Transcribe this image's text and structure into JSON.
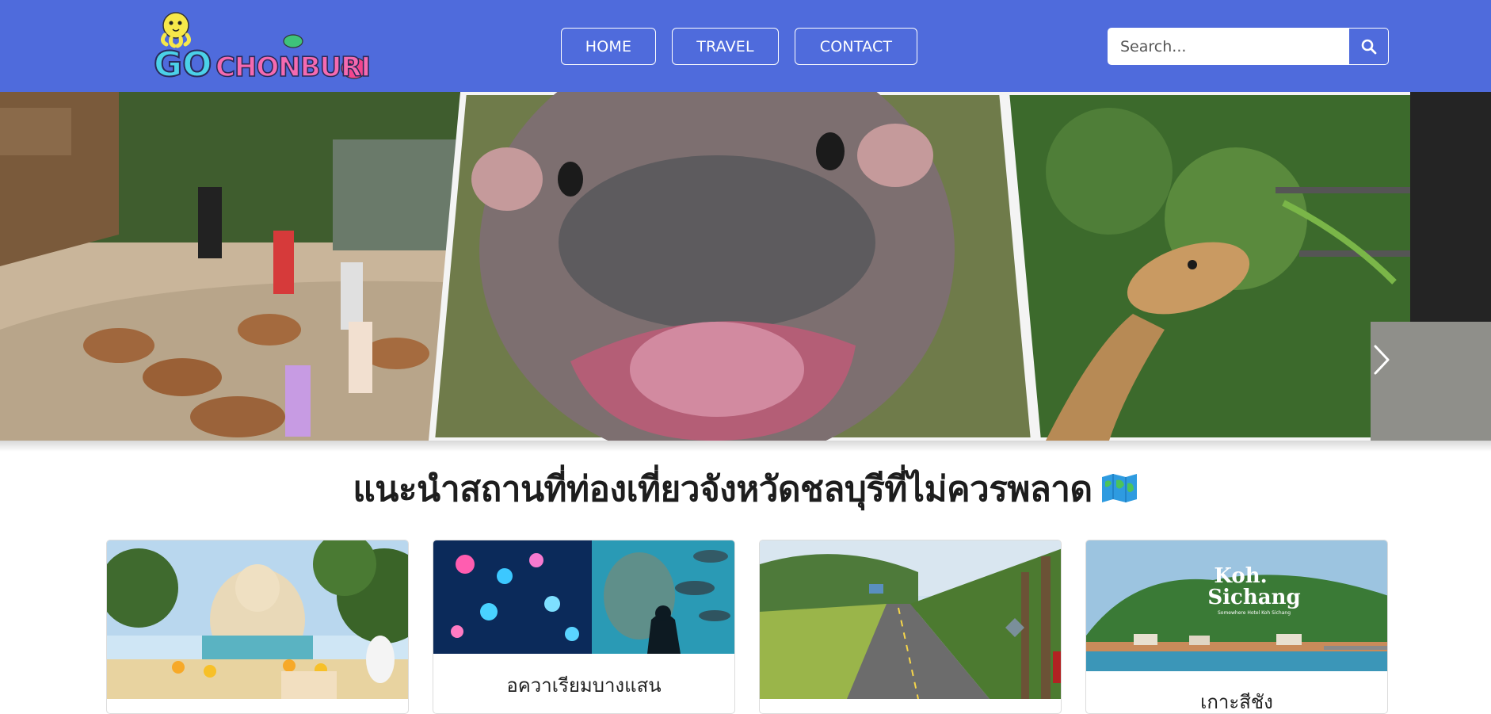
{
  "brand": {
    "logo_text_go": "GO",
    "logo_text_city": "CHONBURI"
  },
  "nav": {
    "home": "HOME",
    "travel": "TRAVEL",
    "contact": "CONTACT"
  },
  "search": {
    "placeholder": "Search..."
  },
  "colors": {
    "navbar": "#4f6bdc",
    "text": "#1d1d1d",
    "card_border": "#dcdcdc"
  },
  "hero": {
    "slides": [
      "capybara-petting-zoo",
      "baby-hippo-closeup",
      "giraffe-feeding"
    ],
    "next_icon": "chevron-right-icon"
  },
  "section": {
    "title": "แนะนำสถานที่ท่องเที่ยวจังหวัดชลบุรีที่ไม่ควรพลาด",
    "title_icon": "world-map-icon"
  },
  "cards": [
    {
      "title": ""
    },
    {
      "title": "อควาเรียมบางแสน"
    },
    {
      "title": ""
    },
    {
      "title": "เกาะสีชัง",
      "image_caption_1": "Koh.",
      "image_caption_2": "Sichang",
      "image_caption_3": "Somewhere Hotel Koh Sichang"
    }
  ]
}
